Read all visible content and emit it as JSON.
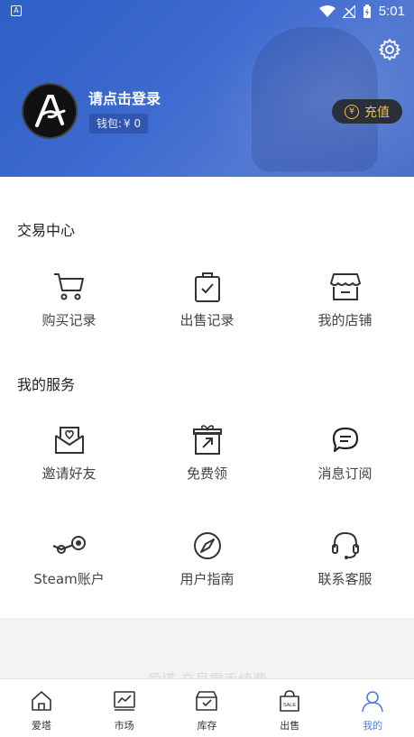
{
  "status_bar": {
    "time": "5:01",
    "left_icon_text": "A"
  },
  "profile": {
    "login_prompt": "请点击登录",
    "wallet_label": "钱包:",
    "wallet_amount": "¥ 0",
    "recharge_label": "充值",
    "recharge_symbol": "¥"
  },
  "trade_center": {
    "title": "交易中心",
    "items": [
      {
        "label": "购买记录",
        "icon": "cart-icon"
      },
      {
        "label": "出售记录",
        "icon": "sell-bag-icon"
      },
      {
        "label": "我的店铺",
        "icon": "store-icon"
      }
    ]
  },
  "my_services": {
    "title": "我的服务",
    "items": [
      {
        "label": "邀请好友",
        "icon": "invite-letter-icon"
      },
      {
        "label": "免费领",
        "icon": "gift-box-icon"
      },
      {
        "label": "消息订阅",
        "icon": "message-icon"
      },
      {
        "label": "Steam账户",
        "icon": "steam-icon"
      },
      {
        "label": "用户指南",
        "icon": "compass-icon"
      },
      {
        "label": "联系客服",
        "icon": "headset-icon"
      }
    ]
  },
  "bottom_faded_text": "爱塔 交易零手续费",
  "tabbar": {
    "active": "我的",
    "items": [
      {
        "label": "爱塔",
        "icon": "home-icon"
      },
      {
        "label": "市场",
        "icon": "market-chart-icon"
      },
      {
        "label": "库存",
        "icon": "inventory-icon"
      },
      {
        "label": "出售",
        "icon": "sale-bag-icon",
        "badge_text": "SALE"
      },
      {
        "label": "我的",
        "icon": "user-icon"
      }
    ]
  },
  "colors": {
    "header": "#3d6bd0",
    "accent": "#4a7fe0",
    "recharge_text": "#f0c040"
  }
}
